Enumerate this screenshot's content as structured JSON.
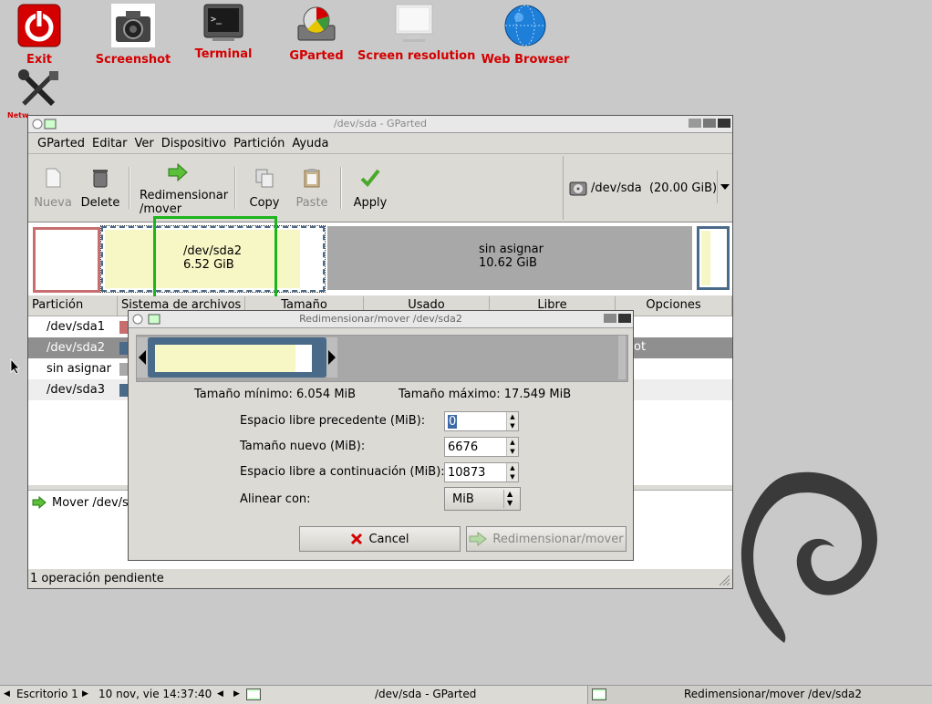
{
  "desktop": {
    "icons": [
      {
        "label": "Exit",
        "icon": "power-icon"
      },
      {
        "label": "Screenshot",
        "icon": "camera-icon"
      },
      {
        "label": "Terminal",
        "icon": "terminal-icon"
      },
      {
        "label": "GParted",
        "icon": "gparted-icon"
      },
      {
        "label": "Screen resolution",
        "icon": "monitor-icon"
      },
      {
        "label": "Web Browser",
        "icon": "globe-icon"
      },
      {
        "label": "Netw",
        "icon": "tools-icon"
      }
    ]
  },
  "main_window": {
    "title": "/dev/sda - GParted",
    "menu": [
      "GParted",
      "Editar",
      "Ver",
      "Dispositivo",
      "Partición",
      "Ayuda"
    ],
    "toolbar": {
      "new": "Nueva",
      "delete": "Delete",
      "resize": "Redimensionar\n/mover",
      "resize_line1": "Redimensionar",
      "resize_line2": "/mover",
      "copy": "Copy",
      "paste": "Paste",
      "apply": "Apply"
    },
    "device": {
      "name": "/dev/sda",
      "size": "(20.00 GiB)"
    },
    "partition_bar": {
      "sda2_name": "/dev/sda2",
      "sda2_size": "6.52 GiB",
      "unalloc_name": "sin asignar",
      "unalloc_size": "10.62 GiB"
    },
    "columns": [
      "Partición",
      "Sistema de archivos",
      "Tamaño",
      "Usado",
      "Libre",
      "Opciones"
    ],
    "rows": [
      {
        "partition": "/dev/sda1",
        "color": "#c86e6e",
        "flags": ""
      },
      {
        "partition": "/dev/sda2",
        "color": "#4a6a8a",
        "flags": "ot"
      },
      {
        "partition": "sin asignar",
        "color": "#a8a8a8",
        "flags": ""
      },
      {
        "partition": "/dev/sda3",
        "color": "#4a6a8a",
        "flags": ""
      }
    ],
    "pending_operation": "Mover /dev/sd",
    "status": "1 operación pendiente"
  },
  "dialog": {
    "title": "Redimensionar/mover /dev/sda2",
    "min_size": "Tamaño mínimo: 6.054 MiB",
    "max_size": "Tamaño máximo: 17.549 MiB",
    "fields": {
      "free_before_label": "Espacio libre precedente (MiB):",
      "free_before_value": "0",
      "new_size_label": "Tamaño nuevo (MiB):",
      "new_size_value": "6676",
      "free_after_label": "Espacio libre a continuación (MiB):",
      "free_after_value": "10873",
      "align_label": "Alinear con:",
      "align_value": "MiB"
    },
    "cancel": "Cancel",
    "resize_button": "Redimensionar/mover"
  },
  "taskbar": {
    "workspace": "Escritorio 1",
    "datetime": "10 nov, vie 14:37:40",
    "task1": "/dev/sda - GParted",
    "task2": "Redimensionar/mover /dev/sda2"
  },
  "colors": {
    "accent_red": "#d40000",
    "sda2_fill": "#f7f6c5",
    "partition_border": "#4a6a8a",
    "selection": "#8f8f8f"
  }
}
